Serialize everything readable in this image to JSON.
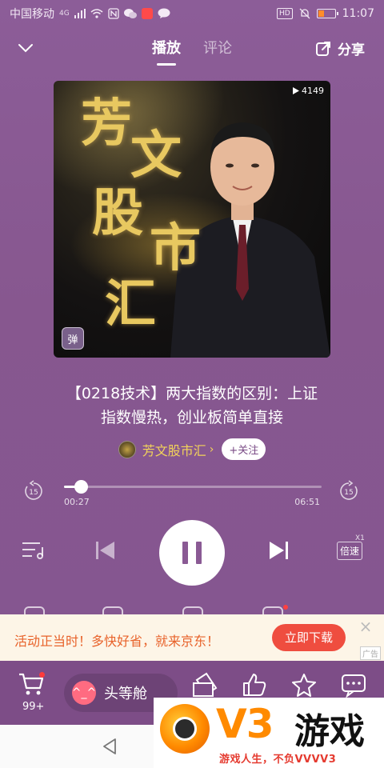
{
  "status_bar": {
    "carrier": "中国移动",
    "network": "4G",
    "time": "11:07",
    "hd_label": "HD"
  },
  "nav": {
    "tabs": [
      {
        "label": "播放",
        "active": true
      },
      {
        "label": "评论",
        "active": false
      }
    ],
    "share_label": "分享"
  },
  "cover": {
    "play_count": "4149",
    "title_chars": [
      "芳",
      "文",
      "股",
      "市",
      "汇"
    ],
    "danmu_label": "弹"
  },
  "episode": {
    "title_line1": "【0218技术】两大指数的区别：上证",
    "title_line2": "指数慢热，创业板简单直接"
  },
  "author": {
    "name": "芳文股市汇",
    "follow_label": "+关注"
  },
  "player": {
    "current_time": "00:27",
    "total_time": "06:51",
    "progress": 0.066,
    "rewind_label": "15",
    "forward_label": "15",
    "speed_label": "倍速",
    "speed_value": "X1"
  },
  "ad": {
    "text": "活动正当时！多快好省，就来京东！",
    "button_label": "立即下载",
    "tag": "广告"
  },
  "bottom_bar": {
    "cart_count": "99+",
    "vip_label": "头等舱"
  },
  "watermark": {
    "brand_v3": "V3",
    "brand_cn": "游戏",
    "slogan": "游戏人生，不负VVVV3"
  },
  "colors": {
    "background": "#8a5a94",
    "author_gold": "#f2d35a",
    "ad_button": "#ef4d3f",
    "ad_text": "#e8622a"
  }
}
